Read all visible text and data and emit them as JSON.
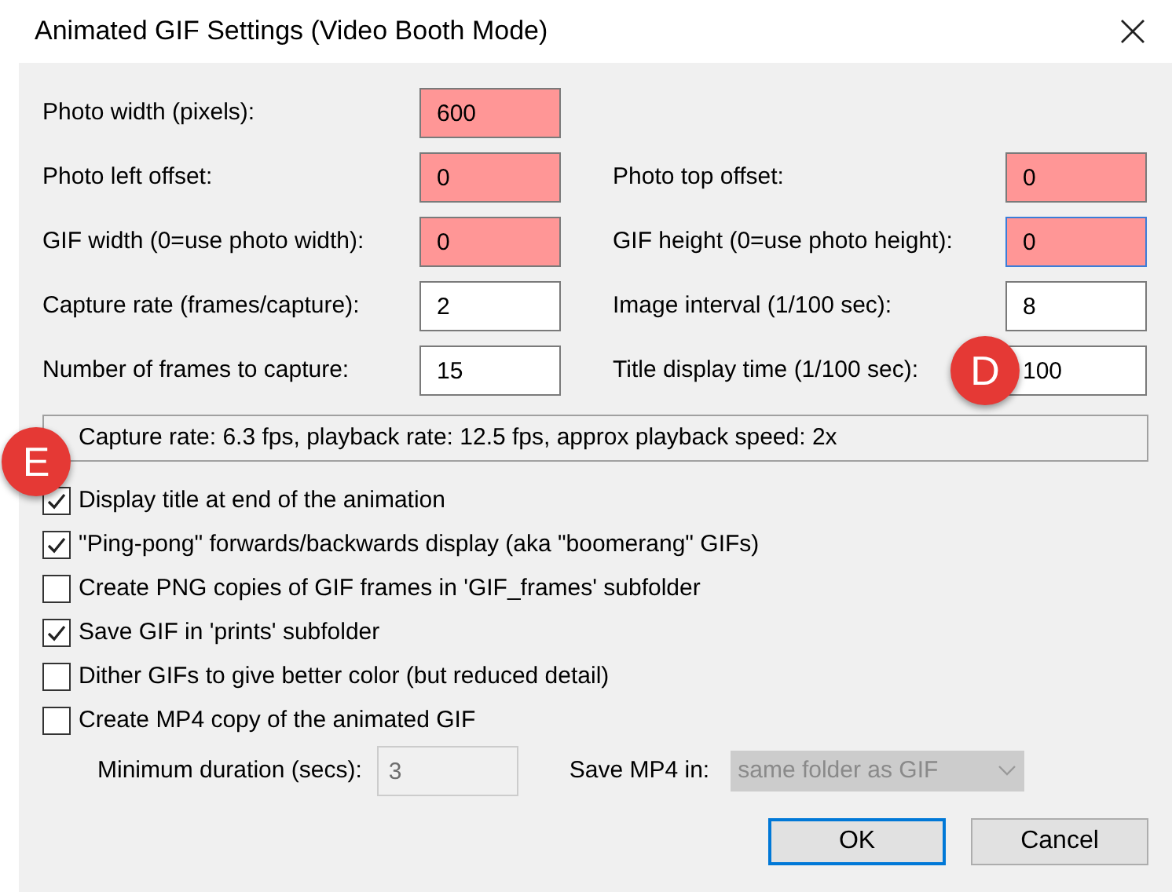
{
  "window": {
    "title": "Animated GIF Settings (Video Booth Mode)"
  },
  "rows": [
    {
      "left": {
        "label": "Photo width (pixels):",
        "value": "600",
        "highlighted": true,
        "focused": false
      }
    },
    {
      "left": {
        "label": "Photo left offset:",
        "value": "0",
        "highlighted": true,
        "focused": false
      },
      "right": {
        "label": "Photo top offset:",
        "value": "0",
        "highlighted": true,
        "focused": false
      }
    },
    {
      "left": {
        "label": "GIF width (0=use photo width):",
        "value": "0",
        "highlighted": true,
        "focused": false
      },
      "right": {
        "label": "GIF height (0=use photo height):",
        "value": "0",
        "highlighted": true,
        "focused": true
      }
    },
    {
      "left": {
        "label": "Capture rate (frames/capture):",
        "value": "2",
        "highlighted": false,
        "focused": false
      },
      "right": {
        "label": "Image interval (1/100 sec):",
        "value": "8",
        "highlighted": false,
        "focused": false
      }
    },
    {
      "left": {
        "label": "Number of frames to capture:",
        "value": "15",
        "highlighted": false,
        "focused": false
      },
      "right": {
        "label": "Title display time (1/100 sec):",
        "value": "100",
        "highlighted": false,
        "focused": false,
        "badge": "D"
      }
    }
  ],
  "summary": {
    "text": "Capture rate: 6.3 fps, playback rate: 12.5 fps, approx playback speed: 2x",
    "badge": "E"
  },
  "options": [
    {
      "label": "Display title at end of the animation",
      "checked": true
    },
    {
      "label": "\"Ping-pong\" forwards/backwards display (aka \"boomerang\" GIFs)",
      "checked": true
    },
    {
      "label": "Create PNG copies of GIF frames in 'GIF_frames' subfolder",
      "checked": false
    },
    {
      "label": "Save GIF in 'prints' subfolder",
      "checked": true
    },
    {
      "label": "Dither GIFs to give better color (but reduced detail)",
      "checked": false
    },
    {
      "label": "Create MP4 copy of the animated GIF",
      "checked": false
    }
  ],
  "mp4": {
    "duration": {
      "label": "Minimum duration (secs):",
      "value": "3",
      "disabled": true
    },
    "save_in": {
      "label": "Save MP4 in:",
      "value": "same folder as GIF",
      "disabled": true
    }
  },
  "buttons": [
    {
      "label": "OK",
      "default": true
    },
    {
      "label": "Cancel",
      "default": false
    }
  ]
}
